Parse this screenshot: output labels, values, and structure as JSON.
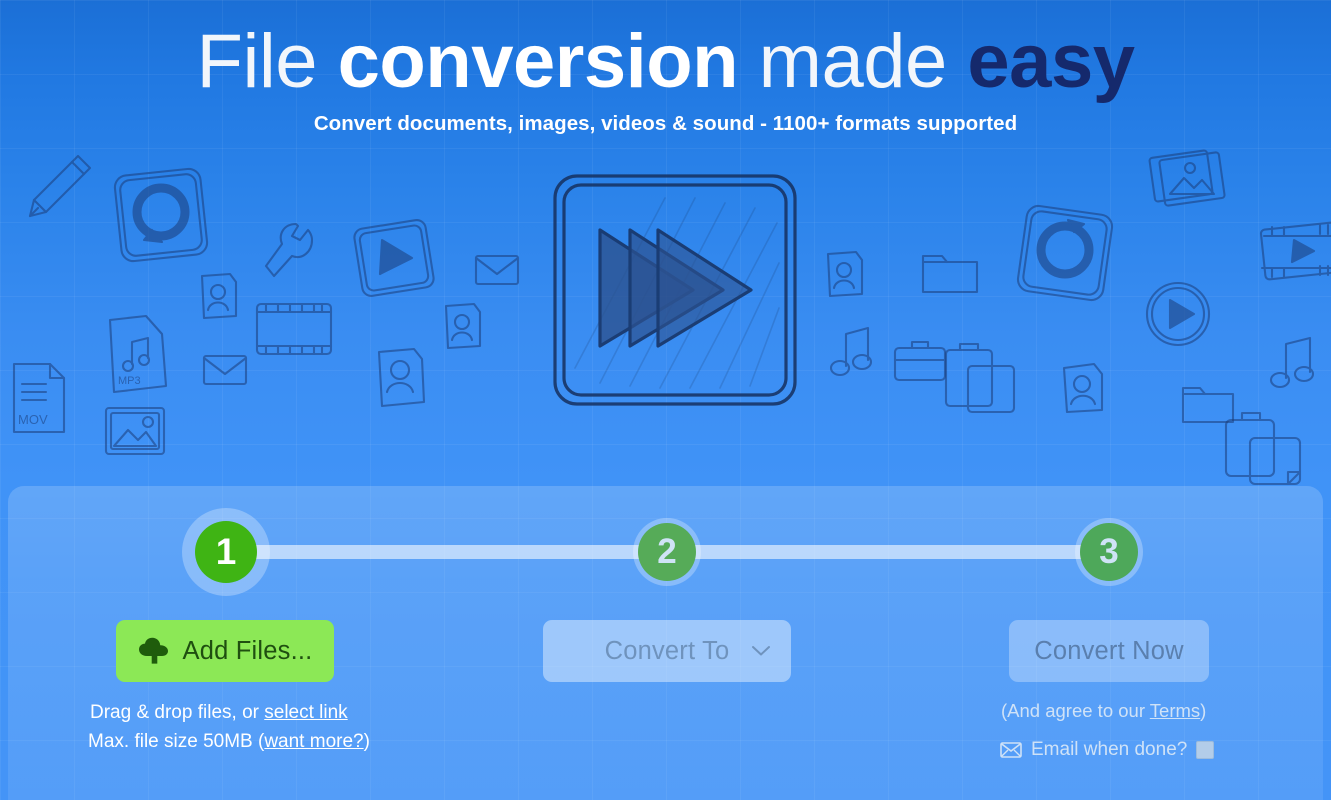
{
  "theme": {
    "bg_top": "#1b6fd6",
    "bg_bottom": "#4494f7",
    "headline_dark": "#15296c",
    "accent_green": "#3fb414",
    "button_green": "#8ce856",
    "button_green_text": "#1f4f10",
    "muted_green": "#56ab58",
    "disabled_text": "#6f93bd",
    "helper_text": "#ffffff",
    "terms_text": "#cfe2f7"
  },
  "hero": {
    "headline_part1": "File ",
    "headline_part2": "conversion",
    "headline_part3": " made ",
    "headline_part4": "easy",
    "subtitle": "Convert documents, images, videos & sound - 1100+ formats supported",
    "illustration": "fast-forward-icon"
  },
  "stepper": {
    "steps": [
      {
        "number": "1",
        "state": "active"
      },
      {
        "number": "2",
        "state": "disabled"
      },
      {
        "number": "3",
        "state": "disabled"
      }
    ]
  },
  "actions": {
    "add_files": {
      "label": "Add Files...",
      "icon": "cloud-upload-icon",
      "enabled": true
    },
    "convert_to": {
      "label": "Convert To",
      "icon": "chevron-down-icon",
      "enabled": false,
      "selected": "Convert To"
    },
    "convert_now": {
      "label": "Convert Now",
      "enabled": false
    }
  },
  "helpers": {
    "drag_prefix": "Drag & drop files, or ",
    "drag_link": "select link",
    "size_prefix": "Max. file size 50MB (",
    "size_link": "want more?",
    "size_suffix": ")",
    "terms_prefix": "(And agree to our ",
    "terms_link": "Terms",
    "terms_suffix": ")",
    "email_icon": "envelope-icon",
    "email_label": "Email when done?",
    "email_checked": false
  },
  "doodles": [
    {
      "name": "pencil-icon"
    },
    {
      "name": "refresh-square-icon"
    },
    {
      "name": "mp3-file-icon"
    },
    {
      "name": "mov-file-icon"
    },
    {
      "name": "envelope-icon"
    },
    {
      "name": "image-frame-icon"
    },
    {
      "name": "contact-card-icon"
    },
    {
      "name": "wrench-icon"
    },
    {
      "name": "play-square-icon"
    },
    {
      "name": "film-strip-icon"
    },
    {
      "name": "photos-stack-icon"
    },
    {
      "name": "play-circle-icon"
    },
    {
      "name": "music-note-icon"
    },
    {
      "name": "folder-icon"
    },
    {
      "name": "briefcase-icon"
    },
    {
      "name": "clipboard-copy-icon"
    }
  ]
}
